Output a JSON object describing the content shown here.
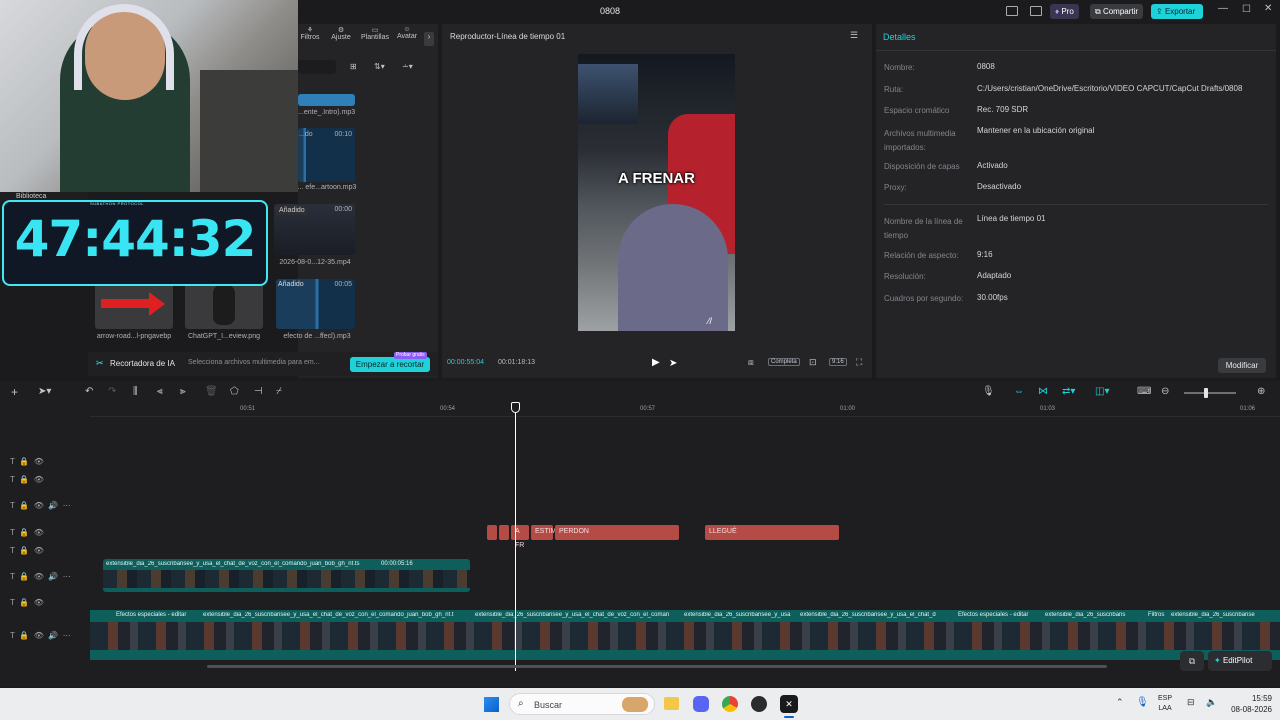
{
  "window": {
    "title": "0808"
  },
  "titlebar": {
    "pro": "Pro",
    "share": "Compartir",
    "export": "Exportar"
  },
  "media_tools": {
    "tabs": [
      "Filtros",
      "Ajuste",
      "Plantillas",
      "Avatar"
    ]
  },
  "webcam_overlay": {
    "library_label": "Biblioteca",
    "hud_caption": "SUBATHON PROTOCOL",
    "timer": "47:44:32"
  },
  "media": {
    "items": [
      {
        "caption": "...ente_.Intro).mp3",
        "badge": "",
        "duration": ""
      },
      {
        "caption": "... efe...artoon.mp3",
        "badge": "...do",
        "duration": "00:10"
      },
      {
        "caption": "2026-08-0...12-35.mp4",
        "badge": "Añadido",
        "duration": "00:00"
      },
      {
        "caption": "arrow-road...l-pngavebp",
        "badge": "",
        "duration": ""
      },
      {
        "caption": "ChatGPT_I...eview.png",
        "badge": "",
        "duration": ""
      },
      {
        "caption": "efecto de ...ffecl).mp3",
        "badge": "Añadido",
        "duration": "00:05"
      }
    ],
    "ai_cutter": "Recortadora de IA",
    "ai_hint": "Selecciona archivos multimedia para em...",
    "start_cut": "Empezar a recortar",
    "try_free": "Probar gratis"
  },
  "player": {
    "title": "Reproductor-Línea de tiempo 01",
    "overlay_text": "A FRENAR",
    "current_time": "00:00:55:04",
    "total_time": "00:01:18:13",
    "full_label": "Completa",
    "ratio_label": "9:16"
  },
  "details": {
    "title": "Detalles",
    "rows": [
      {
        "label": "Nombre:",
        "value": "0808"
      },
      {
        "label": "Ruta:",
        "value": "C:/Users/cristian/OneDrive/Escritorio/VIDEO CAPCUT/CapCut Drafts/0808"
      },
      {
        "label": "Espacio cromático",
        "value": "Rec. 709 SDR"
      },
      {
        "label": "Archivos multimedia importados:",
        "value": "Mantener en la ubicación original"
      },
      {
        "label": "Disposición de capas",
        "value": "Activado"
      },
      {
        "label": "Proxy:",
        "value": "Desactivado"
      },
      {
        "label": "Nombre de la línea de tiempo",
        "value": "Línea de tiempo 01"
      },
      {
        "label": "Relación de aspecto:",
        "value": "9:16"
      },
      {
        "label": "Resolución:",
        "value": "Adaptado"
      },
      {
        "label": "Cuadros por segundo:",
        "value": "30.00fps"
      }
    ],
    "modify": "Modificar"
  },
  "timeline": {
    "ruler": [
      "00:51",
      "00:54",
      "00:57",
      "01:00",
      "01:03",
      "01:06"
    ],
    "text_clips": [
      "A FR",
      "ESTIM",
      "PERDON",
      "LLEGUÉ"
    ],
    "overlay_clip": {
      "name": "extensible_dia_26_suscribansee_y_usa_el_chat_de_voz_con_el_comando_juan_bob_gh_nf.ts",
      "duration": "00:00:05:16"
    },
    "main_clips": [
      "Efectos especiales - editar",
      "extensible_dia_26_suscribansee_y_usa_el_chat_de_voz_con_el_comando_juan_bob_gh_nf.t",
      "extensible_dia_26_suscribansee_y_usa_el_chat_de_voz_con_el_coman",
      "extensible_dia_26_suscribansee_y_usa",
      "extensible_dia_26_suscribansee_y_usa_el_chat_d",
      "Efectos especiales - editar",
      "extensible_dia_26_suscribans",
      "Filtros",
      "extensible_dia_26_suscribanse"
    ],
    "editpilot": "EditPilot"
  },
  "taskbar": {
    "search": "Buscar",
    "lang_top": "ESP",
    "lang_bottom": "LAA",
    "time": "15:59",
    "date": "08-08-2026"
  },
  "colors": {
    "accent": "#1fd1d9",
    "clip_red": "#b54b45",
    "clip_teal": "#0e5f5c",
    "timer": "#39e5f2"
  }
}
